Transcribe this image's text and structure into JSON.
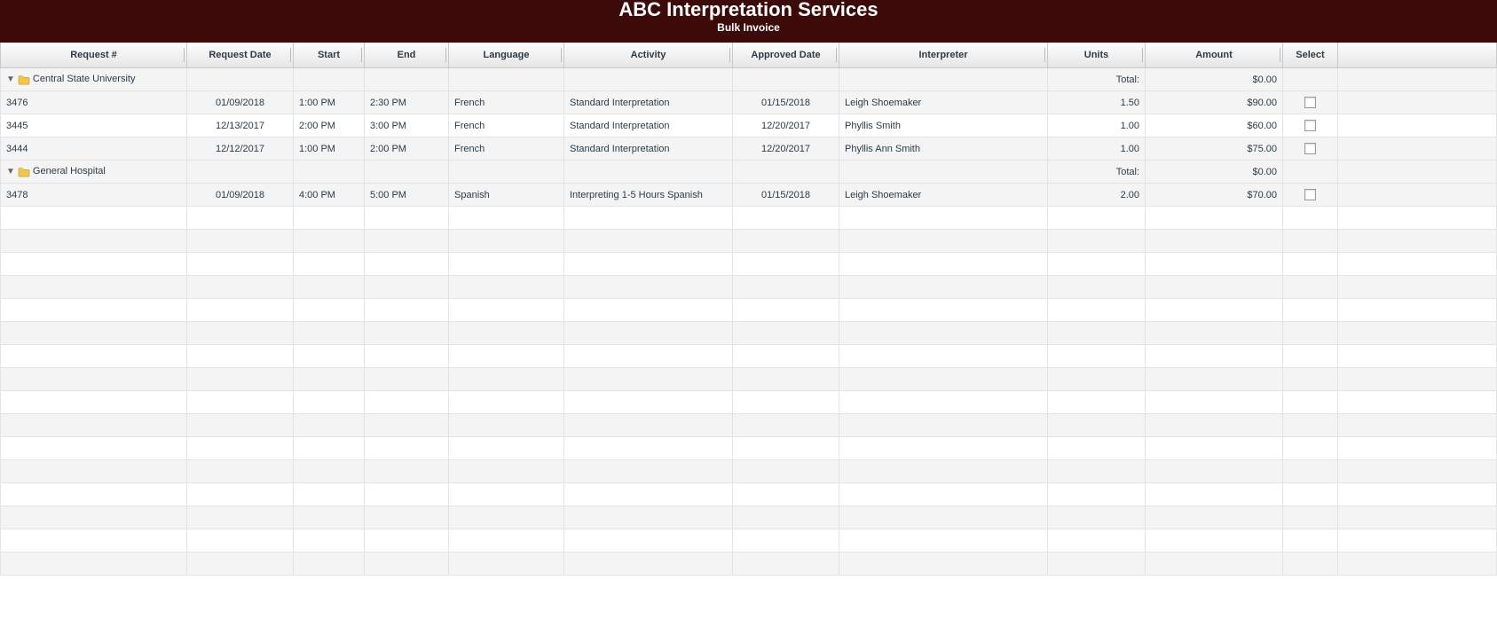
{
  "header": {
    "title": "ABC Interpretation Services",
    "subtitle": "Bulk Invoice"
  },
  "columns": {
    "request_no": "Request #",
    "request_date": "Request Date",
    "start": "Start",
    "end": "End",
    "language": "Language",
    "activity": "Activity",
    "approved_date": "Approved Date",
    "interpreter": "Interpreter",
    "units": "Units",
    "amount": "Amount",
    "select": "Select"
  },
  "groups": [
    {
      "name": "Central State University",
      "total_label": "Total:",
      "total_amount": "$0.00",
      "rows": [
        {
          "request_no": "3476",
          "request_date": "01/09/2018",
          "start": "1:00 PM",
          "end": "2:30 PM",
          "language": "French",
          "activity": "Standard Interpretation",
          "approved_date": "01/15/2018",
          "interpreter": "Leigh Shoemaker",
          "units": "1.50",
          "amount": "$90.00"
        },
        {
          "request_no": "3445",
          "request_date": "12/13/2017",
          "start": "2:00 PM",
          "end": "3:00 PM",
          "language": "French",
          "activity": "Standard Interpretation",
          "approved_date": "12/20/2017",
          "interpreter": "Phyllis Smith",
          "units": "1.00",
          "amount": "$60.00"
        },
        {
          "request_no": "3444",
          "request_date": "12/12/2017",
          "start": "1:00 PM",
          "end": "2:00 PM",
          "language": "French",
          "activity": "Standard Interpretation",
          "approved_date": "12/20/2017",
          "interpreter": "Phyllis Ann Smith",
          "units": "1.00",
          "amount": "$75.00"
        }
      ]
    },
    {
      "name": "General Hospital",
      "total_label": "Total:",
      "total_amount": "$0.00",
      "rows": [
        {
          "request_no": "3478",
          "request_date": "01/09/2018",
          "start": "4:00 PM",
          "end": "5:00 PM",
          "language": "Spanish",
          "activity": "Interpreting 1-5 Hours Spanish",
          "approved_date": "01/15/2018",
          "interpreter": "Leigh Shoemaker",
          "units": "2.00",
          "amount": "$70.00"
        }
      ]
    }
  ],
  "empty_row_count": 16
}
